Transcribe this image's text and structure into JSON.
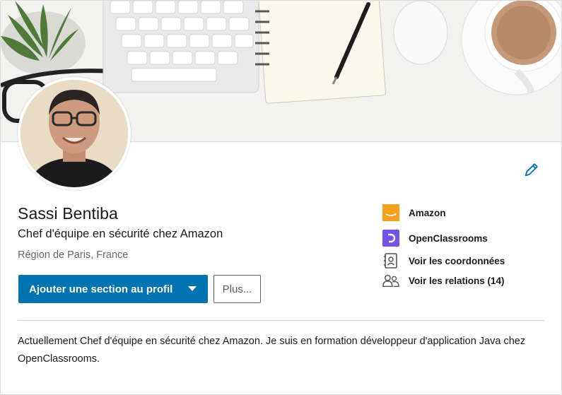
{
  "profile": {
    "name": "Sassi Bentiba",
    "headline": "Chef d'équipe en sécurité chez Amazon",
    "location": "Région de Paris, France",
    "summary": "Actuellement Chef d'équipe en sécurité chez Amazon. Je suis en formation développeur d'application Java chez OpenClassrooms."
  },
  "actions": {
    "add_section_label": "Ajouter une section au profil",
    "more_label": "Plus..."
  },
  "side": {
    "companies": [
      {
        "name": "Amazon",
        "icon": "amazon-logo-icon",
        "color": "#f7a11a"
      },
      {
        "name": "OpenClassrooms",
        "icon": "openclassrooms-logo-icon",
        "color": "#7451eb"
      }
    ],
    "contact_label": "Voir les coordonnées",
    "relations_label": "Voir les relations (14)"
  },
  "colors": {
    "primary": "#0073b1",
    "text": "#000000e6",
    "muted": "#00000099"
  },
  "icons": {
    "edit": "pencil-icon",
    "contact": "contact-card-icon",
    "relations": "people-icon",
    "dropdown": "caret-down-icon"
  }
}
